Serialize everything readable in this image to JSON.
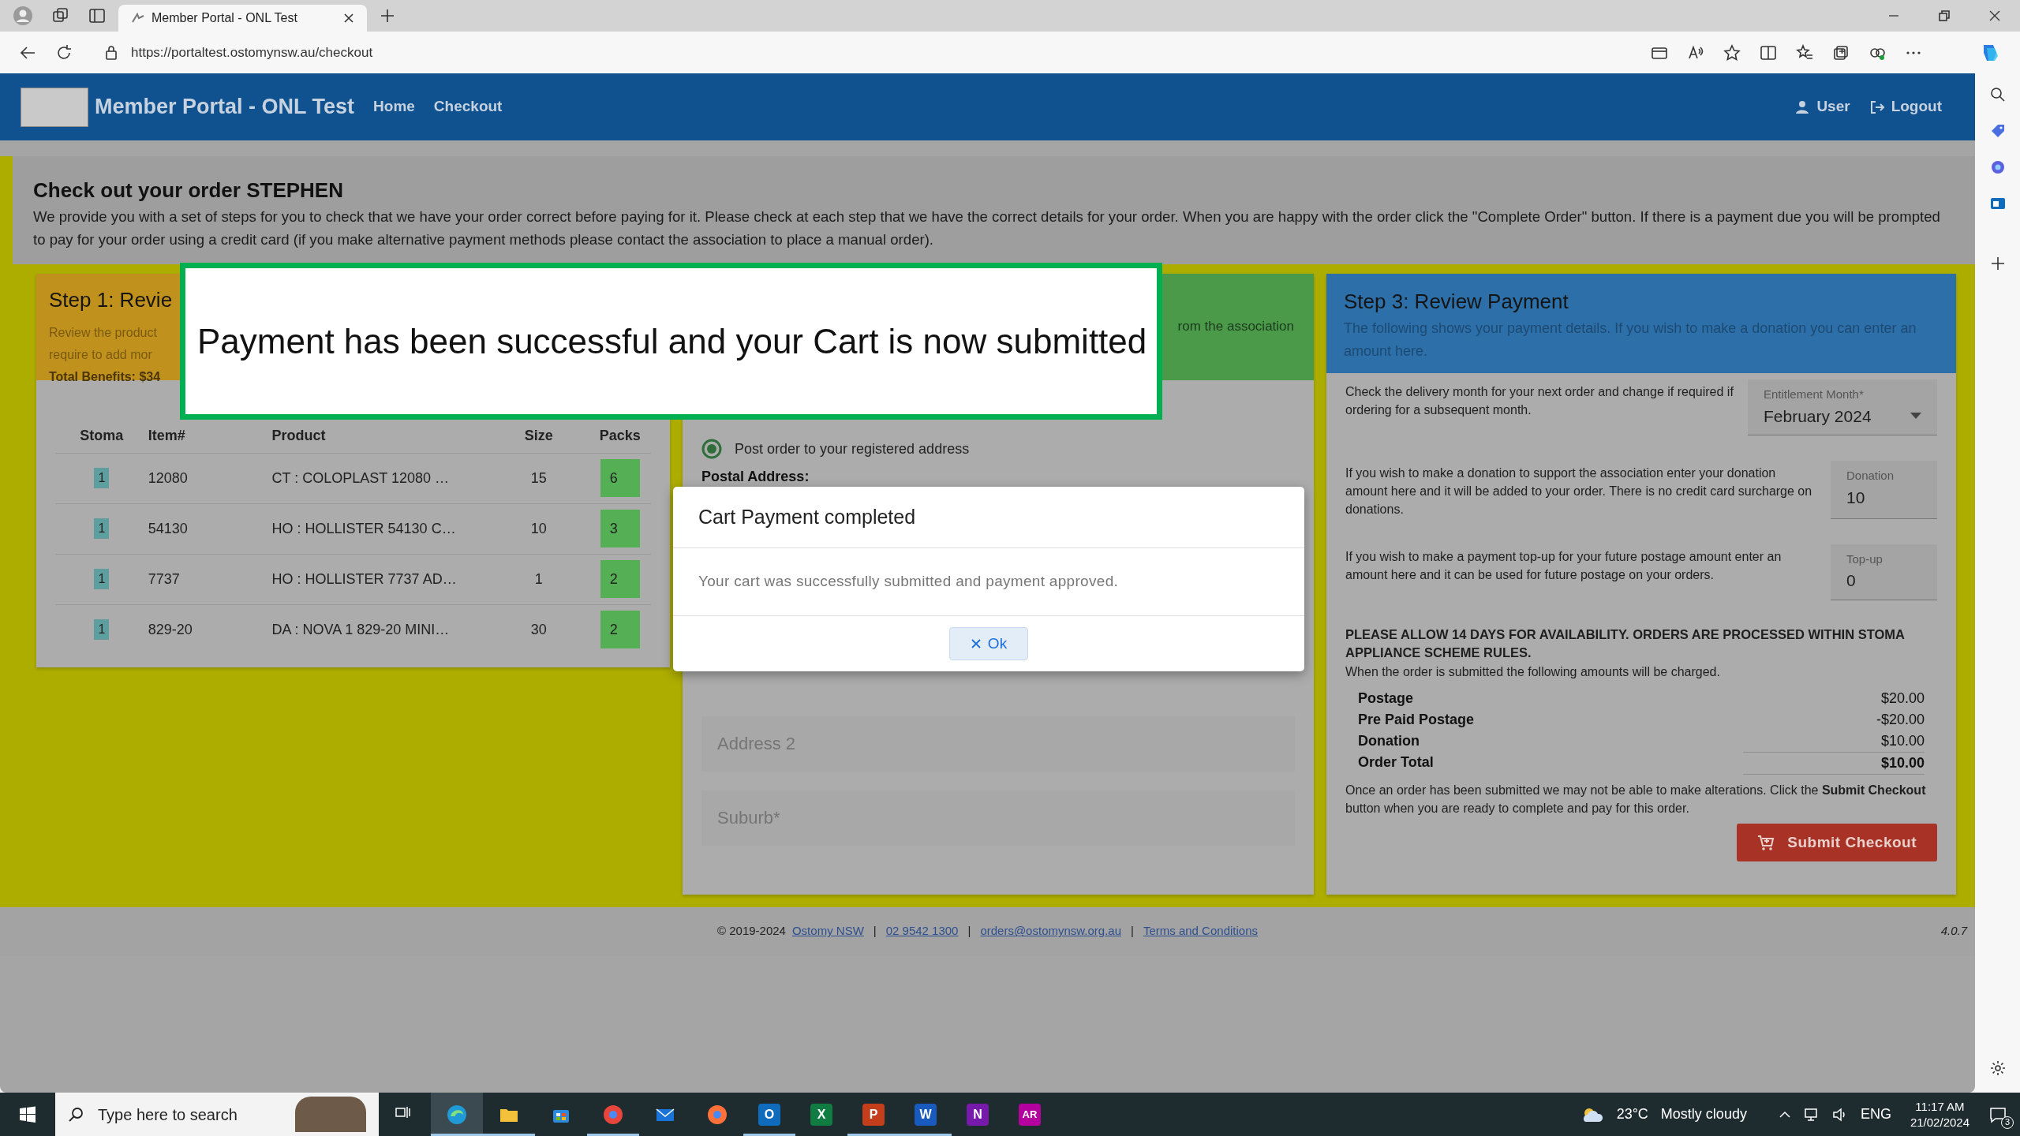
{
  "browser": {
    "tab_title": "Member Portal - ONL Test",
    "url": "https://portaltest.ostomynsw.au/checkout"
  },
  "navbar": {
    "brand": "Member Portal - ONL Test",
    "links": [
      {
        "label": "Home"
      },
      {
        "label": "Checkout"
      }
    ],
    "right_links": [
      {
        "label": "User"
      },
      {
        "label": "Logout"
      }
    ]
  },
  "page": {
    "title": "Check out your order STEPHEN",
    "intro": "We provide you with a set of steps for you to check that we have your order correct before paying for it. Please check at each step that we have the correct details for your order. When you are happy with the order click the \"Complete Order\" button. If there is a payment due you will be prompted to pay for your order using a credit card (if you make alternative payment methods please contact the association to place a manual order)."
  },
  "step1": {
    "title": "Step 1: Revie",
    "lines": [
      "Review the product",
      "require to add mor"
    ],
    "total": "Total Benefits: $34",
    "columns": [
      "Stoma",
      "Item#",
      "Product",
      "Size",
      "Packs"
    ],
    "rows": [
      {
        "stoma": "1",
        "item": "12080",
        "product": "CT : COLOPLAST 12080 …",
        "size": "15",
        "packs": "6"
      },
      {
        "stoma": "1",
        "item": "54130",
        "product": "HO : HOLLISTER 54130 C…",
        "size": "10",
        "packs": "3"
      },
      {
        "stoma": "1",
        "item": "7737",
        "product": "HO : HOLLISTER 7737 AD…",
        "size": "1",
        "packs": "2"
      },
      {
        "stoma": "1",
        "item": "829-20",
        "product": "DA : NOVA 1 829-20 MINI…",
        "size": "30",
        "packs": "2"
      }
    ]
  },
  "step2": {
    "title_fragment": "rom the association",
    "delivery_options": [
      {
        "label": "Post order to your registered address",
        "selected": true
      }
    ],
    "postal_label": "Postal Address:",
    "fields": [
      {
        "placeholder": "Address 2"
      },
      {
        "placeholder": "Suburb*"
      }
    ]
  },
  "step3": {
    "title": "Step 3: Review Payment",
    "subtitle": "The following shows your payment details. If you wish to make a donation you can enter an amount here.",
    "inputs": [
      {
        "kind": "select",
        "text": "Check the delivery month for your next order and change if required if ordering for a subsequent month.",
        "label": "Entitlement Month*",
        "value": "February 2024"
      },
      {
        "kind": "number",
        "text": "If you wish to make a donation to support the association enter your donation amount here and it will be added to your order. There is no credit card surcharge on donations.",
        "label": "Donation",
        "value": "10"
      },
      {
        "kind": "number",
        "text": "If you wish to make a payment top-up for your future postage amount enter an amount here and it can be used for future postage on your orders.",
        "label": "Top-up",
        "value": "0"
      }
    ],
    "notice": "PLEASE ALLOW 14 DAYS FOR AVAILABILITY. ORDERS ARE PROCESSED WITHIN STOMA APPLIANCE SCHEME RULES.",
    "charges_intro": "When the order is submitted the following amounts will be charged.",
    "charges": [
      {
        "kind": "line",
        "label": "Postage",
        "amount": "$20.00"
      },
      {
        "kind": "line",
        "label": "Pre Paid Postage",
        "amount": "-$20.00"
      },
      {
        "kind": "line",
        "label": "Donation",
        "amount": "$10.00"
      },
      {
        "kind": "total",
        "label": "Order Total",
        "amount": "$10.00"
      }
    ],
    "closing": "Once an order has been submitted we may not be able to make alterations. Click the **Submit Checkout** button when you are ready to complete and pay for this order.",
    "submit_button": "Submit Checkout"
  },
  "footer": {
    "items": [
      {
        "kind": "text",
        "text": "© 2019-2024"
      },
      {
        "kind": "link",
        "text": "Ostomy NSW"
      },
      {
        "kind": "separator",
        "text": "|"
      },
      {
        "kind": "link",
        "text": "02 9542 1300"
      },
      {
        "kind": "separator",
        "text": "|"
      },
      {
        "kind": "link",
        "text": "orders@ostomynsw.org.au"
      },
      {
        "kind": "separator",
        "text": "|"
      },
      {
        "kind": "link",
        "text": "Terms and Conditions"
      }
    ],
    "version": "4.0.7"
  },
  "callout": {
    "text": "Payment has been successful and your Cart is now submitted"
  },
  "modal": {
    "title": "Cart Payment completed",
    "body": "Your cart was successfully submitted and payment approved.",
    "button": "Ok"
  },
  "taskbar": {
    "search_placeholder": "Type here to search",
    "apps": [
      {
        "kind": "taskview",
        "running": false,
        "selected": false
      },
      {
        "kind": "swirl",
        "color": "#1f9ad6",
        "running": true,
        "selected": true
      },
      {
        "kind": "folder",
        "color": "#f3c13a",
        "running": true,
        "selected": false
      },
      {
        "kind": "bag",
        "color": "#2a8ae0",
        "running": false,
        "selected": false
      },
      {
        "kind": "ring",
        "color": "#e8453c",
        "running": true,
        "selected": false
      },
      {
        "kind": "envelope",
        "color": "#1a73d9",
        "running": false,
        "selected": false
      },
      {
        "kind": "ring",
        "color": "#ff7139",
        "running": false,
        "selected": false
      },
      {
        "kind": "letter",
        "letter": "O",
        "color": "#0f6cbd",
        "running": true,
        "selected": false
      },
      {
        "kind": "letter",
        "letter": "X",
        "color": "#107c41",
        "running": false,
        "selected": false
      },
      {
        "kind": "letter",
        "letter": "P",
        "color": "#c43e1c",
        "running": true,
        "selected": false
      },
      {
        "kind": "letter",
        "letter": "W",
        "color": "#185abd",
        "running": true,
        "selected": false
      },
      {
        "kind": "letter",
        "letter": "N",
        "color": "#7719aa",
        "running": false,
        "selected": false
      },
      {
        "kind": "letter",
        "letter": "AR",
        "color": "#b4009e",
        "running": false,
        "selected": false
      }
    ],
    "temperature": "23°C",
    "weather": "Mostly cloudy",
    "language": "ENG",
    "time": "11:17 AM",
    "date": "21/02/2024",
    "notification_count": "3"
  }
}
